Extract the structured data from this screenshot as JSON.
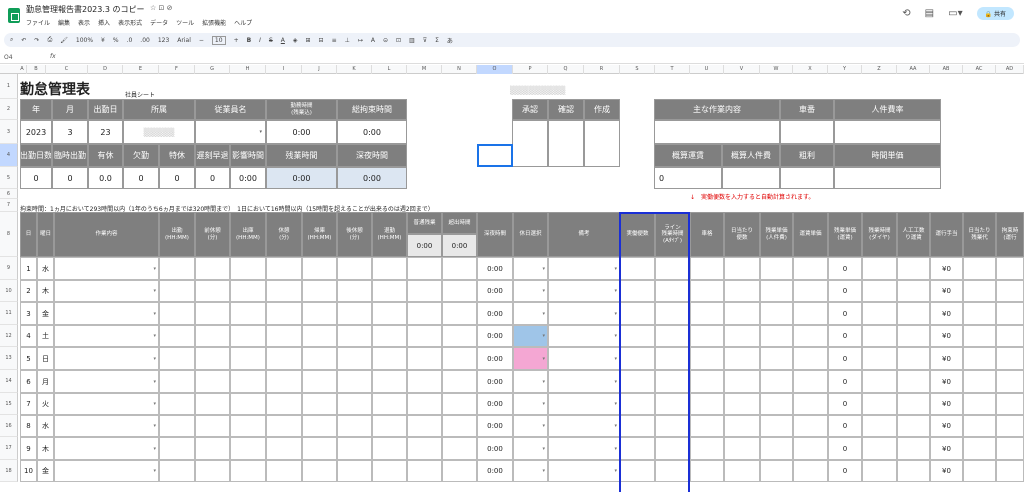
{
  "app": {
    "doc_title": "勤怠管理報告書2023.3 のコピー",
    "menu": [
      "ファイル",
      "編集",
      "表示",
      "挿入",
      "表示形式",
      "データ",
      "ツール",
      "拡張機能",
      "ヘルプ"
    ],
    "share_label": "共有",
    "title_icons": "☆ ⊡ ⊘"
  },
  "toolbar": {
    "zoom": "100%",
    "currency": "¥",
    "percent": "%",
    "dec": ".0",
    "dec2": ".00",
    "format123": "123",
    "font": "Arial",
    "font_size": "10",
    "bold": "B",
    "italic": "I",
    "strike": "S",
    "underline": "A",
    "sigma": "Σ"
  },
  "formula_bar": {
    "name_box": "O4",
    "fx": "fx"
  },
  "columns": [
    "A",
    "B",
    "C",
    "D",
    "E",
    "F",
    "G",
    "H",
    "I",
    "J",
    "K",
    "L",
    "M",
    "N",
    "O",
    "P",
    "Q",
    "R",
    "S",
    "T",
    "U",
    "V",
    "W",
    "X",
    "Y",
    "Z",
    "AA",
    "AB",
    "AC",
    "AD"
  ],
  "rows": [
    "1",
    "2",
    "3",
    "4",
    "5",
    "6",
    "7",
    "8",
    "9",
    "10",
    "11",
    "12",
    "13",
    "14",
    "15",
    "16",
    "17",
    "18"
  ],
  "sheet": {
    "title": "勤怠管理表",
    "subtitle": "社員シート",
    "header_labels": {
      "year": "年",
      "month": "月",
      "start_day": "出勤日",
      "dept": "所属",
      "employee": "従業員名",
      "work_hours": "勤務時間\n(残業込)",
      "total_hours": "総拘束時間",
      "approve": "承認",
      "confirm": "確認",
      "create": "作成",
      "main_work": "主な作業内容",
      "vehicle": "車番",
      "labor_rate": "人件費率",
      "work_days": "出勤日数",
      "holiday_work": "臨時出勤",
      "paid": "有休",
      "absent": "欠勤",
      "special": "特休",
      "late_early": "遅刻早退",
      "late_time": "影響時間",
      "overtime": "残業時間",
      "late_night": "深夜時間",
      "gross_freight": "概算運賃",
      "gross_labor": "概算人件費",
      "profit": "粗利",
      "hourly": "時間単価"
    },
    "values": {
      "year": "2023",
      "month": "3",
      "start_day": "23",
      "work_hours": "0:00",
      "total_hours": "0:00",
      "work_days": "0",
      "holiday_work": "0",
      "paid": "0.0",
      "absent": "0",
      "special": "0",
      "late_early": "0",
      "late_time": "0:00",
      "overtime": "0:00",
      "late_night": "0:00",
      "gross_freight": "0"
    },
    "note_red": "↓　実働便数を入力すると自動計算されます。",
    "note_binding": "拘束時間：1ヵ月において293時間以内（1年のうち6ヵ月までは320時間まで）　1日において16時間以内（15時間を超えることが出来るのは週2回まで）",
    "table_headers": {
      "day": "日",
      "weekday": "曜日",
      "work": "作業内容",
      "clock_in": "出勤\n(HH:MM)",
      "break1": "前休憩\n(分)",
      "clock_out_garage": "出庫\n(HH:MM)",
      "break2": "休憩\n(分)",
      "return_garage": "帰庫\n(HH:MM)",
      "break3": "後休憩\n(分)",
      "clock_out": "退勤\n(HH:MM)",
      "ot_normal": "普通残業",
      "ot_over": "超出時間",
      "late_night": "深夜時間",
      "holiday_select": "休日選択",
      "remarks": "備考",
      "actual_trips": "実働便数",
      "line_hours": "ライン\n残業時間\n(Aﾀｲﾌﾟ)",
      "vehicle": "車格",
      "trips_per_day": "日当たり\n便数",
      "labor_unit": "残業単価\n(人件費)",
      "freight_unit": "運賃単価",
      "ot_freight": "残業単価\n(運賃)",
      "ot_time": "残業時間\n(ダイヤ)",
      "labor_cost": "人工工数\nり運賃",
      "freight_allow": "運行手当",
      "daily_ot": "日当たり\n残業代",
      "binding": "拘束時\n(運行"
    },
    "ot_totals": [
      "0:00",
      "0:00"
    ],
    "days": [
      {
        "d": "1",
        "w": "水",
        "late": "0:00",
        "val": "0",
        "yen": "¥0"
      },
      {
        "d": "2",
        "w": "木",
        "late": "0:00",
        "val": "0",
        "yen": "¥0"
      },
      {
        "d": "3",
        "w": "金",
        "late": "0:00",
        "val": "0",
        "yen": "¥0"
      },
      {
        "d": "4",
        "w": "土",
        "late": "0:00",
        "val": "0",
        "yen": "¥0"
      },
      {
        "d": "5",
        "w": "日",
        "late": "0:00",
        "val": "0",
        "yen": "¥0"
      },
      {
        "d": "6",
        "w": "月",
        "late": "0:00",
        "val": "0",
        "yen": "¥0"
      },
      {
        "d": "7",
        "w": "火",
        "late": "0:00",
        "val": "0",
        "yen": "¥0"
      },
      {
        "d": "8",
        "w": "水",
        "late": "0:00",
        "val": "0",
        "yen": "¥0"
      },
      {
        "d": "9",
        "w": "木",
        "late": "0:00",
        "val": "0",
        "yen": "¥0"
      },
      {
        "d": "10",
        "w": "金",
        "late": "0:00",
        "val": "0",
        "yen": "¥0"
      }
    ],
    "colors": {
      "saturday_fill": "#9fc5e8",
      "sunday_fill": "#f4a7d3",
      "note_red": "#e00000",
      "frame_blue": "#1a2fd6"
    }
  }
}
